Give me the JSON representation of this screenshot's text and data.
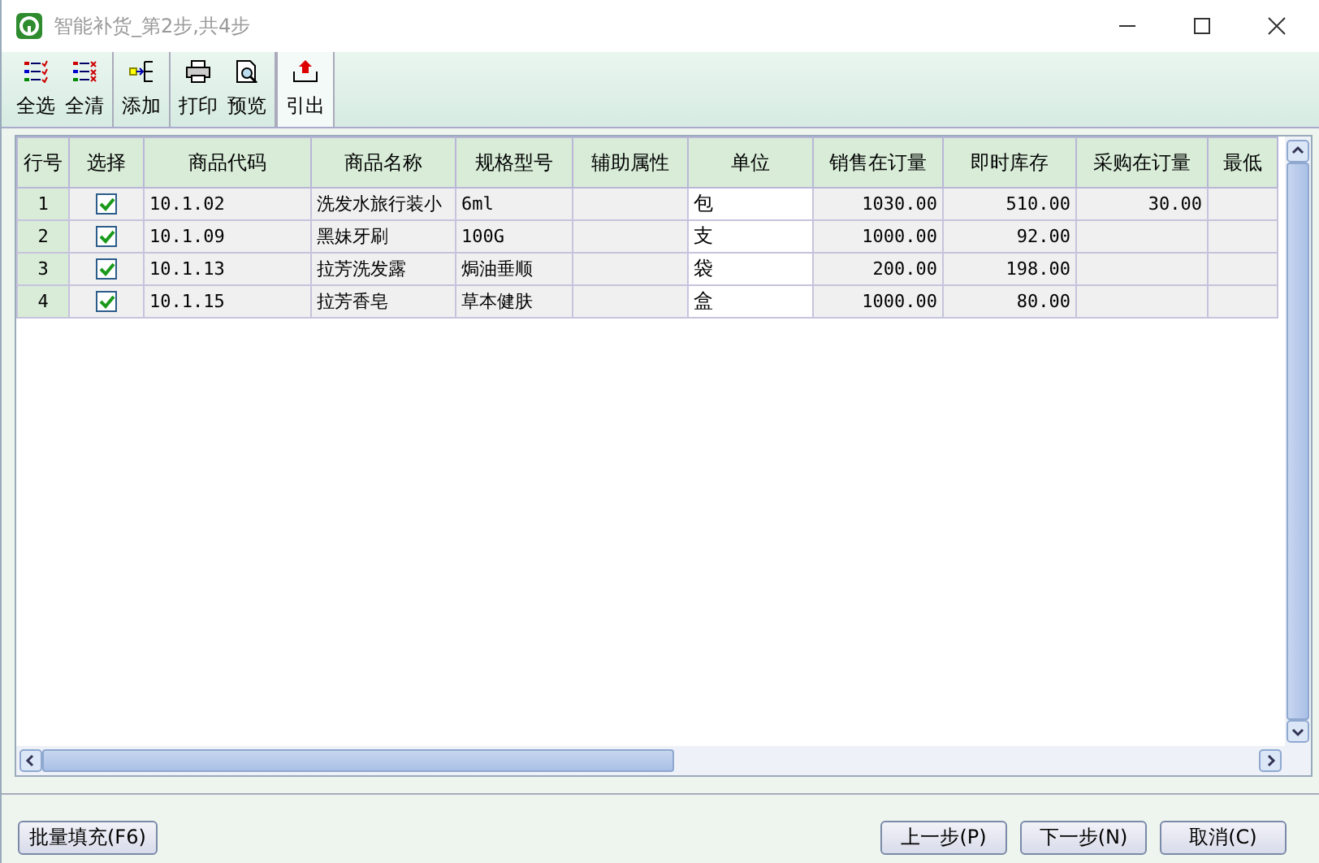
{
  "window": {
    "title": "智能补货_第2步,共4步"
  },
  "toolbar": [
    [
      {
        "label": "全选",
        "kind": "select"
      },
      {
        "label": "全清",
        "kind": "clear"
      }
    ],
    [
      {
        "label": "添加",
        "kind": "add"
      }
    ],
    [
      {
        "label": "打印",
        "kind": "print"
      },
      {
        "label": "预览",
        "kind": "preview"
      }
    ],
    [
      {
        "label": "引出",
        "kind": "export"
      }
    ]
  ],
  "table": {
    "columns": [
      "行号",
      "选择",
      "商品代码",
      "商品名称",
      "规格型号",
      "辅助属性",
      "单位",
      "销售在订量",
      "即时库存",
      "采购在订量",
      "最低"
    ],
    "rows": [
      {
        "no": "1",
        "checked": true,
        "code": "10.1.02",
        "name": "洗发水旅行装小",
        "spec": "6ml",
        "unit": "包",
        "sales": "1030.00",
        "stock": "510.00",
        "purchase": "30.00"
      },
      {
        "no": "2",
        "checked": true,
        "code": "10.1.09",
        "name": "黑妹牙刷",
        "spec": "100G",
        "unit": "支",
        "sales": "1000.00",
        "stock": "92.00"
      },
      {
        "no": "3",
        "checked": true,
        "code": "10.1.13",
        "name": "拉芳洗发露",
        "spec": "焗油垂顺",
        "unit": "袋",
        "sales": "200.00",
        "stock": "198.00"
      },
      {
        "no": "4",
        "checked": true,
        "code": "10.1.15",
        "name": "拉芳香皂",
        "spec": "草本健肤",
        "unit": "盒",
        "sales": "1000.00",
        "stock": "80.00"
      }
    ]
  },
  "footer": {
    "left_button": "批量填充(F6)",
    "buttons": [
      "上一步(P)",
      "下一步(N)",
      "取消(C)"
    ]
  }
}
